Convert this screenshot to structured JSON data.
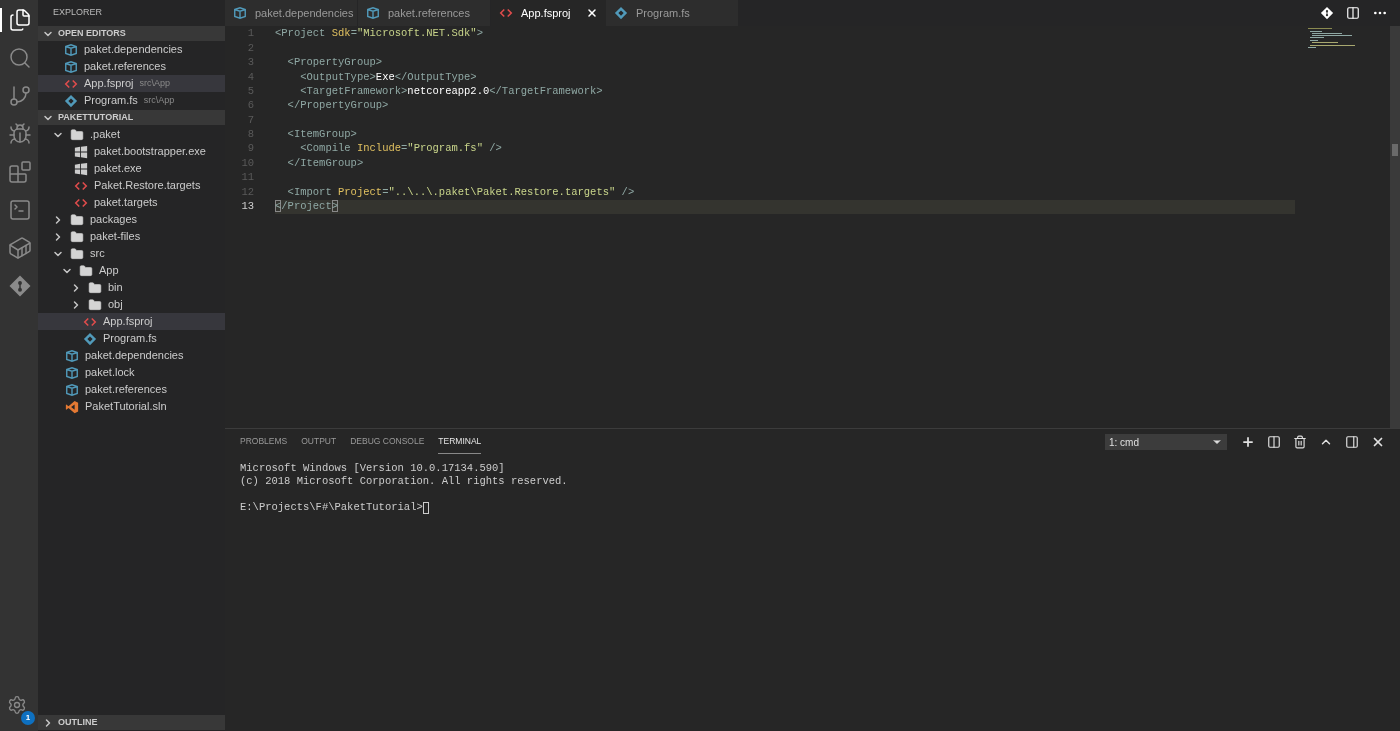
{
  "activity_bar": {
    "items": [
      {
        "kind": "files",
        "selected": true
      },
      {
        "kind": "search",
        "selected": false
      },
      {
        "kind": "source_control",
        "selected": false
      },
      {
        "kind": "debug",
        "selected": false
      },
      {
        "kind": "extensions",
        "selected": false
      },
      {
        "kind": "terminal",
        "selected": false
      },
      {
        "kind": "docker",
        "selected": false
      },
      {
        "kind": "git",
        "selected": false
      }
    ],
    "settings_badge": "1"
  },
  "explorer": {
    "title": "EXPLORER",
    "open_editors": {
      "title": "OPEN EDITORS",
      "expanded": true,
      "items": [
        {
          "name": "paket.dependencies",
          "kind": "package",
          "selected": false
        },
        {
          "name": "paket.references",
          "kind": "package",
          "selected": false
        },
        {
          "name": "App.fsproj",
          "path": "src\\App",
          "kind": "xml",
          "selected": true
        },
        {
          "name": "Program.fs",
          "path": "src\\App",
          "kind": "fsharp",
          "selected": false
        }
      ]
    },
    "project": {
      "title": "PAKETTUTORIAL",
      "expanded": true,
      "tree": [
        {
          "name": ".paket",
          "kind": "folder",
          "expanded": true,
          "selected": false,
          "children": [
            {
              "name": "paket.bootstrapper.exe",
              "kind": "exe",
              "selected": false
            },
            {
              "name": "paket.exe",
              "kind": "exe",
              "selected": false
            },
            {
              "name": "Paket.Restore.targets",
              "kind": "xml",
              "selected": false
            },
            {
              "name": "paket.targets",
              "kind": "xml",
              "selected": false
            }
          ]
        },
        {
          "name": "packages",
          "kind": "folder",
          "expanded": false,
          "selected": false
        },
        {
          "name": "paket-files",
          "kind": "folder",
          "expanded": false,
          "selected": false
        },
        {
          "name": "src",
          "kind": "folder",
          "expanded": true,
          "selected": false,
          "children": [
            {
              "name": "App",
              "kind": "folder",
              "expanded": true,
              "selected": false,
              "children": [
                {
                  "name": "bin",
                  "kind": "folder",
                  "expanded": false,
                  "selected": false
                },
                {
                  "name": "obj",
                  "kind": "folder",
                  "expanded": false,
                  "selected": false
                },
                {
                  "name": "App.fsproj",
                  "kind": "xml",
                  "selected": true
                },
                {
                  "name": "Program.fs",
                  "kind": "fsharp",
                  "selected": false
                }
              ]
            }
          ]
        },
        {
          "name": "paket.dependencies",
          "kind": "package",
          "selected": false
        },
        {
          "name": "paket.lock",
          "kind": "package",
          "selected": false
        },
        {
          "name": "paket.references",
          "kind": "package",
          "selected": false
        },
        {
          "name": "PaketTutorial.sln",
          "kind": "sln",
          "selected": false
        }
      ]
    },
    "outline": {
      "title": "OUTLINE",
      "expanded": false
    }
  },
  "tabs": [
    {
      "label": "paket.dependencies",
      "kind": "package",
      "selected": false
    },
    {
      "label": "paket.references",
      "kind": "package",
      "selected": false
    },
    {
      "label": "App.fsproj",
      "kind": "xml",
      "selected": true
    },
    {
      "label": "Program.fs",
      "kind": "fsharp",
      "selected": false
    }
  ],
  "editor": {
    "lines": [
      {
        "number": "1",
        "current": false,
        "tokens": [
          {
            "text": "<Project",
            "kind": "tag"
          },
          {
            "text": " Sdk",
            "kind": "attr"
          },
          {
            "text": "=",
            "kind": "tag"
          },
          {
            "text": "\"Microsoft.NET.Sdk\"",
            "kind": "string"
          },
          {
            "text": ">",
            "kind": "tag"
          }
        ]
      },
      {
        "number": "2",
        "current": false
      },
      {
        "number": "3",
        "current": false,
        "tokens": [
          {
            "text": "  <PropertyGroup>",
            "kind": "tag"
          }
        ]
      },
      {
        "number": "4",
        "current": false,
        "tokens": [
          {
            "text": "    <OutputType>",
            "kind": "tag"
          },
          {
            "text": "Exe",
            "kind": "text"
          },
          {
            "text": "</OutputType>",
            "kind": "tag"
          }
        ]
      },
      {
        "number": "5",
        "current": false,
        "tokens": [
          {
            "text": "    <TargetFramework>",
            "kind": "tag"
          },
          {
            "text": "netcoreapp2.0",
            "kind": "text"
          },
          {
            "text": "</TargetFramework>",
            "kind": "tag"
          }
        ]
      },
      {
        "number": "6",
        "current": false,
        "tokens": [
          {
            "text": "  </PropertyGroup>",
            "kind": "tag"
          }
        ]
      },
      {
        "number": "7",
        "current": false
      },
      {
        "number": "8",
        "current": false,
        "tokens": [
          {
            "text": "  <ItemGroup>",
            "kind": "tag"
          }
        ]
      },
      {
        "number": "9",
        "current": false,
        "tokens": [
          {
            "text": "    <Compile",
            "kind": "tag"
          },
          {
            "text": " Include",
            "kind": "attr"
          },
          {
            "text": "=",
            "kind": "tag"
          },
          {
            "text": "\"Program.fs\"",
            "kind": "string"
          },
          {
            "text": " />",
            "kind": "tag"
          }
        ]
      },
      {
        "number": "10",
        "current": false,
        "tokens": [
          {
            "text": "  </ItemGroup>",
            "kind": "tag"
          }
        ]
      },
      {
        "number": "11",
        "current": false
      },
      {
        "number": "12",
        "current": false,
        "tokens": [
          {
            "text": "  <Import",
            "kind": "tag"
          },
          {
            "text": " Project",
            "kind": "attr"
          },
          {
            "text": "=",
            "kind": "tag"
          },
          {
            "text": "\"..\\..\\.paket\\Paket.Restore.targets\"",
            "kind": "string"
          },
          {
            "text": " />",
            "kind": "tag"
          }
        ]
      },
      {
        "number": "13",
        "current": true,
        "tokens": [
          {
            "text": "<",
            "kind": "bracket_match"
          },
          {
            "text": "/Project",
            "kind": "tag"
          },
          {
            "text": ">",
            "kind": "bracket_match"
          }
        ]
      }
    ]
  },
  "panel": {
    "tabs": [
      {
        "label": "PROBLEMS",
        "selected": false
      },
      {
        "label": "OUTPUT",
        "selected": false
      },
      {
        "label": "DEBUG CONSOLE",
        "selected": false
      },
      {
        "label": "TERMINAL",
        "selected": true
      }
    ],
    "terminal_select": "1: cmd",
    "terminal_lines": [
      "Microsoft Windows [Version 10.0.17134.590]",
      "(c) 2018 Microsoft Corporation. All rights reserved."
    ],
    "terminal_prompt": "E:\\Projects\\F#\\PaketTutorial>"
  }
}
